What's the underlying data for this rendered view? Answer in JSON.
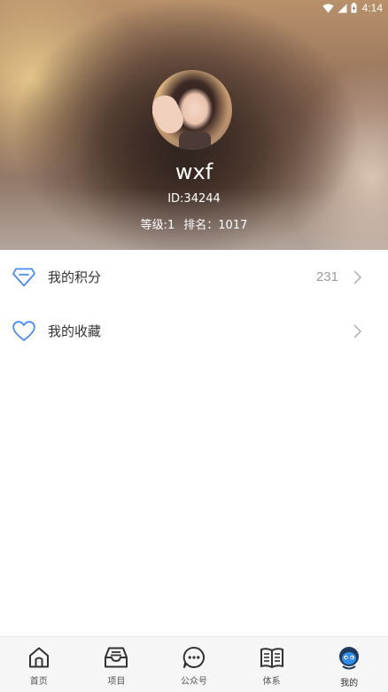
{
  "status_bar": {
    "time": "4:14"
  },
  "profile": {
    "username": "wxf",
    "id_text": "ID:34244",
    "level_text": "等级:1",
    "rank_text": "排名：1017"
  },
  "menu": {
    "points": {
      "label": "我的积分",
      "value": "231"
    },
    "favorites": {
      "label": "我的收藏"
    }
  },
  "tabs": [
    {
      "label": "首页",
      "icon": "home-icon"
    },
    {
      "label": "项目",
      "icon": "inbox-icon"
    },
    {
      "label": "公众号",
      "icon": "chat-icon"
    },
    {
      "label": "体系",
      "icon": "book-icon"
    },
    {
      "label": "我的",
      "icon": "profile-icon"
    }
  ],
  "colors": {
    "accent": "#4a8bf5",
    "text": "#333333",
    "muted": "#999999",
    "tabbar_bg": "#f6f6f6"
  }
}
